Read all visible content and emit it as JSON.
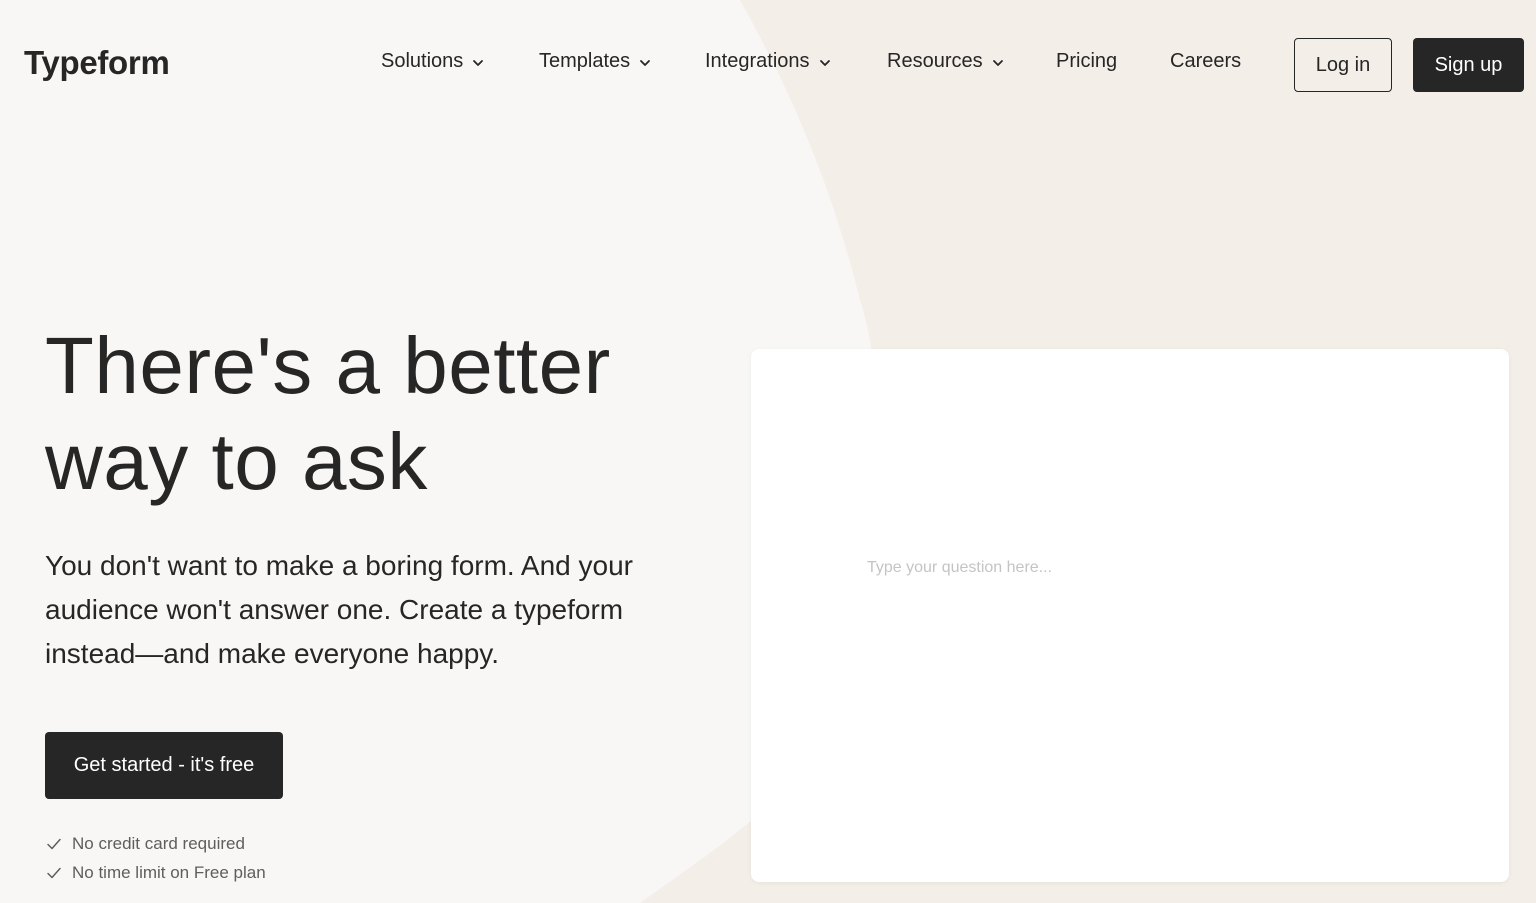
{
  "header": {
    "logo": "Typeform",
    "nav": [
      {
        "label": "Solutions",
        "has_dropdown": true
      },
      {
        "label": "Templates",
        "has_dropdown": true
      },
      {
        "label": "Integrations",
        "has_dropdown": true
      },
      {
        "label": "Resources",
        "has_dropdown": true
      },
      {
        "label": "Pricing",
        "has_dropdown": false
      },
      {
        "label": "Careers",
        "has_dropdown": false
      }
    ],
    "login_label": "Log in",
    "signup_label": "Sign up"
  },
  "hero": {
    "title": "There's a better way to ask",
    "subtitle": "You don't want to make a boring form. And your audience won't answer one. Create a typeform instead—and make everyone happy.",
    "cta_label": "Get started - it's free",
    "checks": [
      "No credit card required",
      "No time limit on Free plan"
    ]
  },
  "preview": {
    "question_placeholder": "Type your question here..."
  },
  "colors": {
    "background": "#f8f7f5",
    "shape": "#f4eee8",
    "ink": "#262627",
    "card": "#ffffff"
  },
  "icons": {
    "dropdown": "chevron-down-icon",
    "check": "check-icon"
  }
}
